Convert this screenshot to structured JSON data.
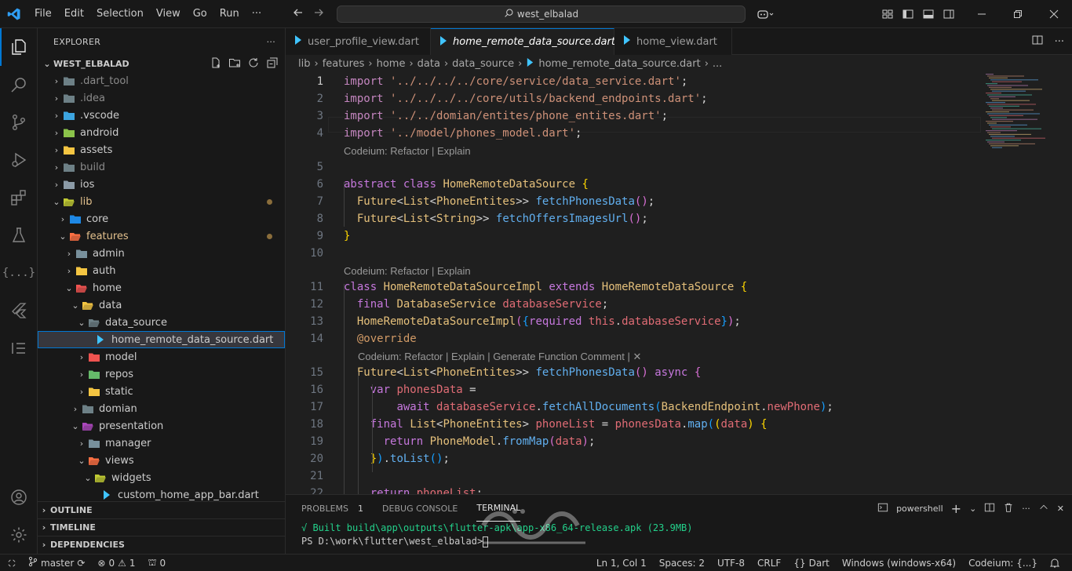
{
  "titlebar": {
    "menu": [
      "File",
      "Edit",
      "Selection",
      "View",
      "Go",
      "Run"
    ],
    "search": "west_elbalad"
  },
  "sidebar": {
    "header": "EXPLORER",
    "project": "WEST_ELBALAD",
    "items": [
      {
        "label": ".dart_tool",
        "depth": 0,
        "open": false,
        "icon": "folder-gray",
        "dim": true
      },
      {
        "label": ".idea",
        "depth": 0,
        "open": false,
        "icon": "folder-gray",
        "dim": true
      },
      {
        "label": ".vscode",
        "depth": 0,
        "open": false,
        "icon": "folder-vscode"
      },
      {
        "label": "android",
        "depth": 0,
        "open": false,
        "icon": "folder-android"
      },
      {
        "label": "assets",
        "depth": 0,
        "open": false,
        "icon": "folder-yellow"
      },
      {
        "label": "build",
        "depth": 0,
        "open": false,
        "icon": "folder-gray",
        "dim": true
      },
      {
        "label": "ios",
        "depth": 0,
        "open": false,
        "icon": "folder-ios"
      },
      {
        "label": "lib",
        "depth": 0,
        "open": true,
        "icon": "folder-lib",
        "gold": true,
        "dot": true
      },
      {
        "label": "core",
        "depth": 1,
        "open": false,
        "icon": "folder-core"
      },
      {
        "label": "features",
        "depth": 1,
        "open": true,
        "icon": "folder-features",
        "gold": true,
        "dot": true
      },
      {
        "label": "admin",
        "depth": 2,
        "open": false,
        "icon": "folder-admin"
      },
      {
        "label": "auth",
        "depth": 2,
        "open": false,
        "icon": "folder-yellow"
      },
      {
        "label": "home",
        "depth": 2,
        "open": true,
        "icon": "folder-home"
      },
      {
        "label": "data",
        "depth": 3,
        "open": true,
        "icon": "folder-yellow"
      },
      {
        "label": "data_source",
        "depth": 4,
        "open": true,
        "icon": "folder-gray"
      },
      {
        "label": "home_remote_data_source.dart",
        "depth": 5,
        "file": true,
        "icon": "dart",
        "selected": true
      },
      {
        "label": "model",
        "depth": 4,
        "open": false,
        "icon": "folder-model"
      },
      {
        "label": "repos",
        "depth": 4,
        "open": false,
        "icon": "folder-repos"
      },
      {
        "label": "static",
        "depth": 4,
        "open": false,
        "icon": "folder-yellow"
      },
      {
        "label": "domian",
        "depth": 3,
        "open": false,
        "icon": "folder-gray"
      },
      {
        "label": "presentation",
        "depth": 3,
        "open": true,
        "icon": "folder-presentation"
      },
      {
        "label": "manager",
        "depth": 4,
        "open": false,
        "icon": "folder-manager"
      },
      {
        "label": "views",
        "depth": 4,
        "open": true,
        "icon": "folder-views"
      },
      {
        "label": "widgets",
        "depth": 5,
        "open": true,
        "icon": "folder-widgets"
      },
      {
        "label": "custom_home_app_bar.dart",
        "depth": 6,
        "file": true,
        "icon": "dart"
      }
    ],
    "sections": [
      "OUTLINE",
      "TIMELINE",
      "DEPENDENCIES"
    ]
  },
  "tabs": [
    {
      "label": "user_profile_view.dart",
      "active": false
    },
    {
      "label": "home_remote_data_source.dart",
      "active": true
    },
    {
      "label": "home_view.dart",
      "active": false
    }
  ],
  "breadcrumbs": [
    "lib",
    "features",
    "home",
    "data",
    "data_source",
    "home_remote_data_source.dart",
    "..."
  ],
  "code": {
    "lenses": [
      {
        "after": 4,
        "text": "Codeium: Refactor | Explain",
        "indent": 0
      },
      {
        "after": 10,
        "text": "Codeium: Refactor | Explain",
        "indent": 0
      },
      {
        "after": 14,
        "text": "Codeium: Refactor | Explain | Generate Function Comment | ✕",
        "indent": 1
      }
    ],
    "lines": [
      {
        "n": "1",
        "tokens": [
          [
            "k",
            "import"
          ],
          [
            "w",
            " "
          ],
          [
            "s",
            "'../../../../core/service/data_service.dart'"
          ],
          [
            "w",
            ";"
          ]
        ]
      },
      {
        "n": "2",
        "tokens": [
          [
            "k",
            "import"
          ],
          [
            "w",
            " "
          ],
          [
            "s",
            "'../../../../core/utils/backend_endpoints.dart'"
          ],
          [
            "w",
            ";"
          ]
        ]
      },
      {
        "n": "3",
        "tokens": [
          [
            "k",
            "import"
          ],
          [
            "w",
            " "
          ],
          [
            "s",
            "'../../domian/entites/phone_entites.dart'"
          ],
          [
            "w",
            ";"
          ]
        ]
      },
      {
        "n": "4",
        "tokens": [
          [
            "k",
            "import"
          ],
          [
            "w",
            " "
          ],
          [
            "s",
            "'../model/phones_model.dart'"
          ],
          [
            "w",
            ";"
          ]
        ]
      },
      {
        "n": "5",
        "tokens": []
      },
      {
        "n": "6",
        "tokens": [
          [
            "p",
            "abstract"
          ],
          [
            "w",
            " "
          ],
          [
            "p",
            "class"
          ],
          [
            "w",
            " "
          ],
          [
            "ty",
            "HomeRemoteDataSource"
          ],
          [
            "w",
            " "
          ],
          [
            "br1",
            "{"
          ]
        ]
      },
      {
        "n": "7",
        "tokens": [
          [
            "w",
            "  "
          ],
          [
            "ty",
            "Future"
          ],
          [
            "w",
            "<"
          ],
          [
            "ty",
            "List"
          ],
          [
            "w",
            "<"
          ],
          [
            "ty",
            "PhoneEntites"
          ],
          [
            "w",
            ">> "
          ],
          [
            "f",
            "fetchPhonesData"
          ],
          [
            "br2",
            "()"
          ],
          [
            "w",
            ";"
          ]
        ]
      },
      {
        "n": "8",
        "tokens": [
          [
            "w",
            "  "
          ],
          [
            "ty",
            "Future"
          ],
          [
            "w",
            "<"
          ],
          [
            "ty",
            "List"
          ],
          [
            "w",
            "<"
          ],
          [
            "ty",
            "String"
          ],
          [
            "w",
            ">> "
          ],
          [
            "f",
            "fetchOffersImagesUrl"
          ],
          [
            "br2",
            "()"
          ],
          [
            "w",
            ";"
          ]
        ]
      },
      {
        "n": "9",
        "tokens": [
          [
            "br1",
            "}"
          ]
        ]
      },
      {
        "n": "10",
        "tokens": []
      },
      {
        "n": "11",
        "tokens": [
          [
            "p",
            "class"
          ],
          [
            "w",
            " "
          ],
          [
            "ty",
            "HomeRemoteDataSourceImpl"
          ],
          [
            "w",
            " "
          ],
          [
            "p",
            "extends"
          ],
          [
            "w",
            " "
          ],
          [
            "ty",
            "HomeRemoteDataSource"
          ],
          [
            "w",
            " "
          ],
          [
            "br1",
            "{"
          ]
        ]
      },
      {
        "n": "12",
        "tokens": [
          [
            "w",
            "  "
          ],
          [
            "p",
            "final"
          ],
          [
            "w",
            " "
          ],
          [
            "ty",
            "DatabaseService"
          ],
          [
            "w",
            " "
          ],
          [
            "v",
            "databaseService"
          ],
          [
            "w",
            ";"
          ]
        ]
      },
      {
        "n": "13",
        "tokens": [
          [
            "w",
            "  "
          ],
          [
            "ty",
            "HomeRemoteDataSourceImpl"
          ],
          [
            "br2",
            "("
          ],
          [
            "br3",
            "{"
          ],
          [
            "p",
            "required"
          ],
          [
            "w",
            " "
          ],
          [
            "v",
            "this"
          ],
          [
            "w",
            "."
          ],
          [
            "v",
            "databaseService"
          ],
          [
            "br3",
            "}"
          ],
          [
            "br2",
            ")"
          ],
          [
            "w",
            ";"
          ]
        ]
      },
      {
        "n": "14",
        "tokens": [
          [
            "w",
            "  "
          ],
          [
            "ann",
            "@override"
          ]
        ]
      },
      {
        "n": "15",
        "tokens": [
          [
            "w",
            "  "
          ],
          [
            "ty",
            "Future"
          ],
          [
            "w",
            "<"
          ],
          [
            "ty",
            "List"
          ],
          [
            "w",
            "<"
          ],
          [
            "ty",
            "PhoneEntites"
          ],
          [
            "w",
            ">> "
          ],
          [
            "f",
            "fetchPhonesData"
          ],
          [
            "br2",
            "()"
          ],
          [
            "w",
            " "
          ],
          [
            "p",
            "async"
          ],
          [
            "w",
            " "
          ],
          [
            "br2",
            "{"
          ]
        ]
      },
      {
        "n": "16",
        "tokens": [
          [
            "w",
            "    "
          ],
          [
            "p",
            "var"
          ],
          [
            "w",
            " "
          ],
          [
            "v",
            "phonesData"
          ],
          [
            "w",
            " ="
          ]
        ]
      },
      {
        "n": "17",
        "tokens": [
          [
            "w",
            "        "
          ],
          [
            "p",
            "await"
          ],
          [
            "w",
            " "
          ],
          [
            "v",
            "databaseService"
          ],
          [
            "w",
            "."
          ],
          [
            "f",
            "fetchAllDocuments"
          ],
          [
            "br3",
            "("
          ],
          [
            "ty",
            "BackendEndpoint"
          ],
          [
            "w",
            "."
          ],
          [
            "v",
            "newPhone"
          ],
          [
            "br3",
            ")"
          ],
          [
            "w",
            ";"
          ]
        ]
      },
      {
        "n": "18",
        "tokens": [
          [
            "w",
            "    "
          ],
          [
            "p",
            "final"
          ],
          [
            "w",
            " "
          ],
          [
            "ty",
            "List"
          ],
          [
            "w",
            "<"
          ],
          [
            "ty",
            "PhoneEntites"
          ],
          [
            "w",
            "> "
          ],
          [
            "v",
            "phoneList"
          ],
          [
            "w",
            " = "
          ],
          [
            "v",
            "phonesData"
          ],
          [
            "w",
            "."
          ],
          [
            "f",
            "map"
          ],
          [
            "br3",
            "("
          ],
          [
            "br1",
            "("
          ],
          [
            "v",
            "data"
          ],
          [
            "br1",
            ")"
          ],
          [
            "w",
            " "
          ],
          [
            "br1",
            "{"
          ]
        ]
      },
      {
        "n": "19",
        "tokens": [
          [
            "w",
            "      "
          ],
          [
            "p",
            "return"
          ],
          [
            "w",
            " "
          ],
          [
            "ty",
            "PhoneModel"
          ],
          [
            "w",
            "."
          ],
          [
            "f",
            "fromMap"
          ],
          [
            "br2",
            "("
          ],
          [
            "v",
            "data"
          ],
          [
            "br2",
            ")"
          ],
          [
            "w",
            ";"
          ]
        ]
      },
      {
        "n": "20",
        "tokens": [
          [
            "w",
            "    "
          ],
          [
            "br1",
            "}"
          ],
          [
            "br3",
            ")"
          ],
          [
            "w",
            "."
          ],
          [
            "f",
            "toList"
          ],
          [
            "br3",
            "()"
          ],
          [
            "w",
            ";"
          ]
        ]
      },
      {
        "n": "21",
        "tokens": []
      },
      {
        "n": "22",
        "tokens": [
          [
            "w",
            "    "
          ],
          [
            "p",
            "return"
          ],
          [
            "w",
            " "
          ],
          [
            "v",
            "phoneList"
          ],
          [
            "w",
            ";"
          ]
        ]
      }
    ]
  },
  "panel": {
    "tabs": [
      {
        "label": "PROBLEMS",
        "badge": "1"
      },
      {
        "label": "DEBUG CONSOLE"
      },
      {
        "label": "TERMINAL",
        "active": true
      }
    ],
    "shell": "powershell",
    "terminal": [
      "√ Built build\\app\\outputs\\flutter-apk\\app-x86_64-release.apk (23.9MB)",
      "PS D:\\work\\flutter\\west_elbalad>"
    ]
  },
  "status": {
    "branch": "master",
    "errors": "0",
    "warnings": "1",
    "ports": "0",
    "position": "Ln 1, Col 1",
    "spaces": "Spaces: 2",
    "encoding": "UTF-8",
    "eol": "CRLF",
    "language": "Dart",
    "device": "Windows (windows-x64)",
    "codeium": "Codeium: {...}"
  },
  "colors": {
    "accent": "#0078d4",
    "folder": "#dcb67a",
    "dart": "#40c4ff"
  }
}
